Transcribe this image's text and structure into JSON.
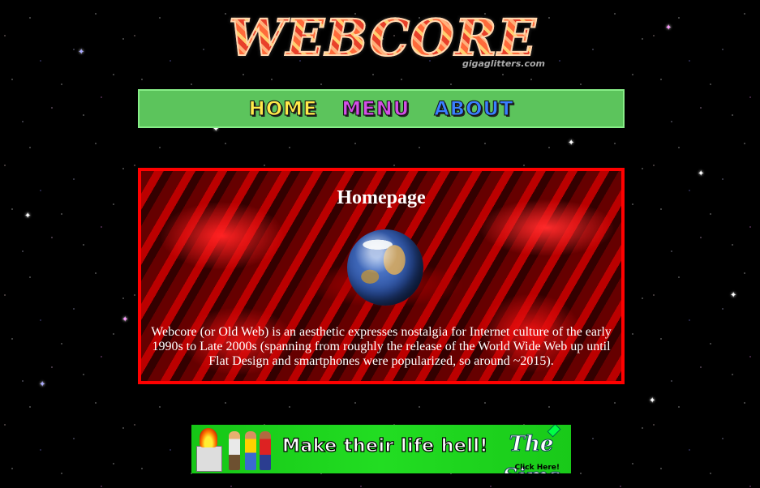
{
  "logo": {
    "text": "WEBCORE",
    "credit": "gigaglitters.com"
  },
  "nav": {
    "items": [
      {
        "label": "HOME",
        "color": "#ffe94a"
      },
      {
        "label": "MENU",
        "color": "#d24fe6"
      },
      {
        "label": "ABOUT",
        "color": "#3a7fff"
      }
    ],
    "background": "#5cc45c"
  },
  "content": {
    "title": "Homepage",
    "image_icon": "spinning-globe-icon",
    "body": "Webcore (or Old Web) is an aesthetic expresses nostalgia for Internet culture of the early 1990s to Late 2000s (spanning from roughly the release of the World Wide Web up until Flat Design and smartphones were popularized, so around ~2015).",
    "border_color": "#ff0000"
  },
  "banner": {
    "text": "Make their life hell!",
    "brand": "The Sims",
    "cta": "Click Here!",
    "background": "#22dd22"
  }
}
